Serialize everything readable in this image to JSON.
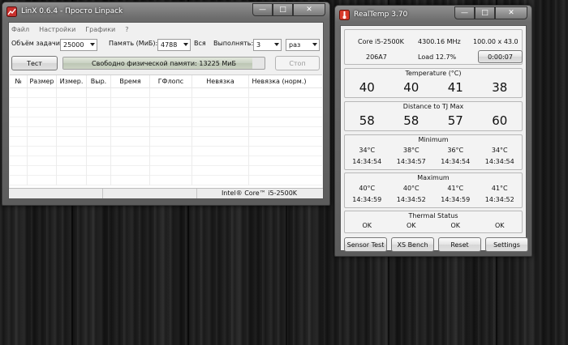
{
  "linx": {
    "title": "LinX 0.6.4 - Просто Linpack",
    "menu": [
      "Файл",
      "Настройки",
      "Графики",
      "?"
    ],
    "problem_size_label": "Объём задачи:",
    "problem_size_value": "25000",
    "memory_label": "Память (МиБ):",
    "memory_value": "4788",
    "all_label": "Вся",
    "run_label": "Выполнять:",
    "run_value": "3",
    "run_unit_value": "раз",
    "test_button": "Тест",
    "stop_button": "Стоп",
    "progress_text": "Свободно физической памяти: 13225 МиБ",
    "progress_fraction": 0.94,
    "columns": [
      "№",
      "Размер",
      "Измер.",
      "Выр.",
      "Время",
      "ГФлопс",
      "Невязка",
      "Невязка (норм.)"
    ],
    "cpu_status": "Intel® Core™ i5-2500K"
  },
  "realtemp": {
    "title": "RealTemp 3.70",
    "cpu_name": "Core i5-2500K",
    "frequency": "4300.16 MHz",
    "multiplier": "100.00 x 43.0",
    "cpuid": "206A7",
    "load": "Load  12.7%",
    "timer": "0:00:07",
    "temperature_title": "Temperature (°C)",
    "temperatures": [
      "40",
      "40",
      "41",
      "38"
    ],
    "distance_title": "Distance to TJ Max",
    "distances": [
      "58",
      "58",
      "57",
      "60"
    ],
    "minimum_title": "Minimum",
    "minimum_temps": [
      "34°C",
      "38°C",
      "36°C",
      "34°C"
    ],
    "minimum_times": [
      "14:34:54",
      "14:34:57",
      "14:34:54",
      "14:34:54"
    ],
    "maximum_title": "Maximum",
    "maximum_temps": [
      "40°C",
      "40°C",
      "41°C",
      "41°C"
    ],
    "maximum_times": [
      "14:34:59",
      "14:34:52",
      "14:34:59",
      "14:34:52"
    ],
    "thermal_title": "Thermal Status",
    "thermal_status": [
      "OK",
      "OK",
      "OK",
      "OK"
    ],
    "buttons": {
      "sensor_test": "Sensor Test",
      "xs_bench": "XS Bench",
      "reset": "Reset",
      "settings": "Settings"
    }
  }
}
